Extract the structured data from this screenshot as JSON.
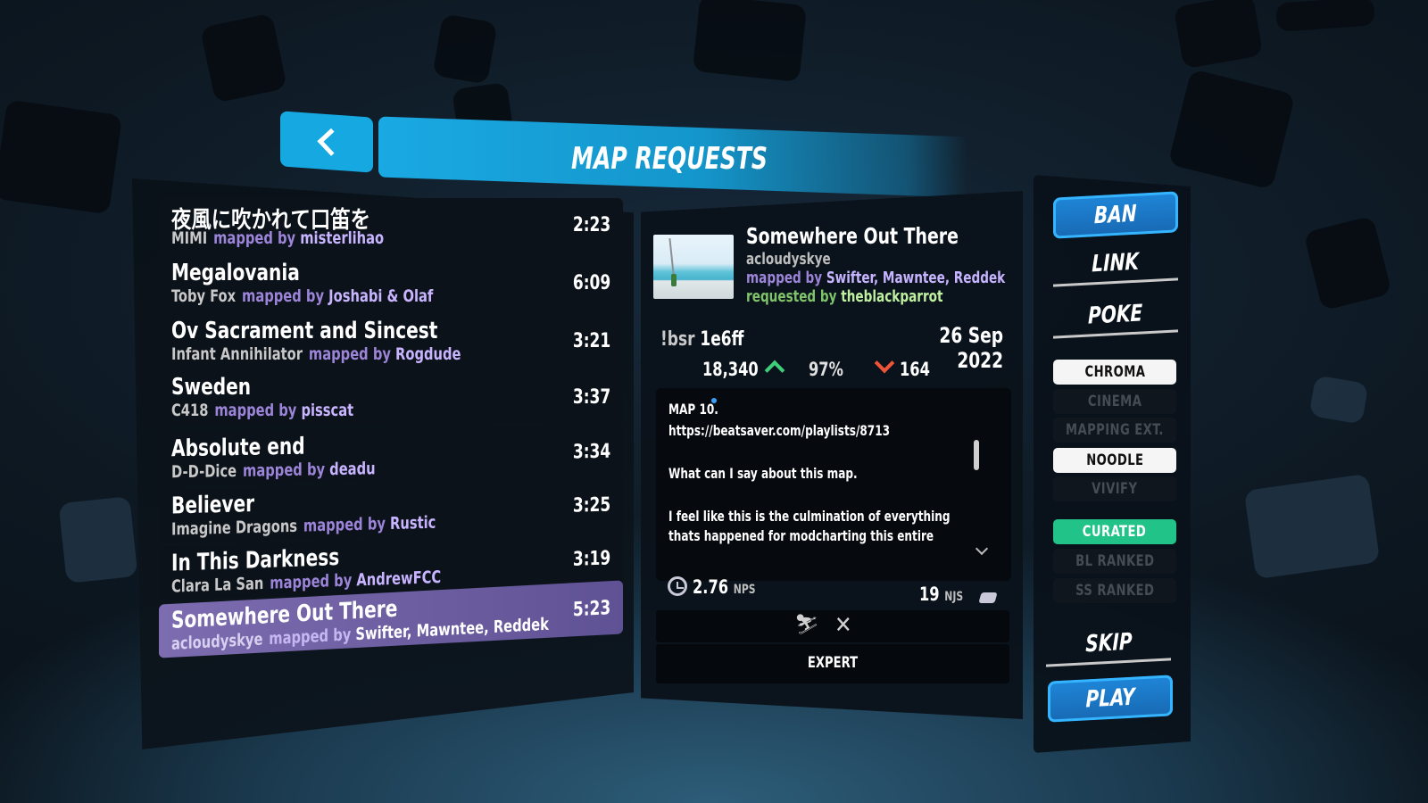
{
  "header": {
    "title": "MAP REQUESTS"
  },
  "songs": [
    {
      "title": "夜風に吹かれて口笛を",
      "artist": "MIMI",
      "mapped_by_label": "mapped by",
      "mapper": "misterlihao",
      "duration": "2:23"
    },
    {
      "title": "Megalovania",
      "artist": "Toby Fox",
      "mapped_by_label": "mapped by",
      "mapper": "Joshabi & Olaf",
      "duration": "6:09"
    },
    {
      "title": "Ov Sacrament and Sincest",
      "artist": "Infant Annihilator",
      "mapped_by_label": "mapped by",
      "mapper": "Rogdude",
      "duration": "3:21"
    },
    {
      "title": "Sweden",
      "artist": "C418",
      "mapped_by_label": "mapped by",
      "mapper": "pisscat",
      "duration": "3:37"
    },
    {
      "title": "Absolute end",
      "artist": "D-D-Dice",
      "mapped_by_label": "mapped by",
      "mapper": "deadu",
      "duration": "3:34"
    },
    {
      "title": "Believer",
      "artist": "Imagine Dragons",
      "mapped_by_label": "mapped by",
      "mapper": "Rustic",
      "duration": "3:25"
    },
    {
      "title": "In This Darkness",
      "artist": "Clara La San",
      "mapped_by_label": "mapped by",
      "mapper": "AndrewFCC",
      "duration": "3:19"
    },
    {
      "title": "Somewhere Out There",
      "artist": "acloudyskye",
      "mapped_by_label": "mapped by",
      "mapper": "Swifter, Mawntee, Reddek",
      "duration": "5:23"
    }
  ],
  "detail": {
    "title": "Somewhere Out There",
    "artist": "acloudyskye",
    "mapped_by_label": "mapped by",
    "mappers": "Swifter, Mawntee, Reddek",
    "requested_by_label": "requested by",
    "requester": "theblackparrot",
    "bsr_label": "!bsr",
    "bsr_code": "1e6ff",
    "date": "26 Sep 2022",
    "upvotes": "18,340",
    "rating": "97%",
    "downvotes": "164",
    "description": [
      "MAP 10.",
      "https://beatsaver.com/playlists/8713",
      "",
      "What can I say about this map.",
      "",
      "I feel like this is the culmination of everything",
      "thats happened for modcharting this entire"
    ],
    "nps_value": "2.76",
    "nps_unit": "NPS",
    "njs_value": "19",
    "njs_unit": "NJS",
    "difficulty": "EXPERT",
    "icons": [
      "no-fail-icon",
      "close-icon",
      "clock-icon",
      "jump-speed-icon"
    ]
  },
  "actions": {
    "ban": "BAN",
    "link": "LINK",
    "poke": "POKE",
    "skip": "SKIP",
    "play": "PLAY"
  },
  "tags": [
    {
      "label": "CHROMA",
      "state": "on"
    },
    {
      "label": "CINEMA",
      "state": "off"
    },
    {
      "label": "MAPPING EXT.",
      "state": "off"
    },
    {
      "label": "NOODLE",
      "state": "on"
    },
    {
      "label": "VIVIFY",
      "state": "off"
    },
    {
      "label": "CURATED",
      "state": "green"
    },
    {
      "label": "BL RANKED",
      "state": "off"
    },
    {
      "label": "SS RANKED",
      "state": "off"
    }
  ],
  "colors": {
    "accent_blue": "#1aa9e3",
    "selected_row": "#7d6cb0",
    "mapped_by": "#9c84d8",
    "requested_by": "#7fc46a",
    "upvote": "#3fcf7a",
    "downvote": "#f0553a",
    "curated": "#22c389"
  }
}
